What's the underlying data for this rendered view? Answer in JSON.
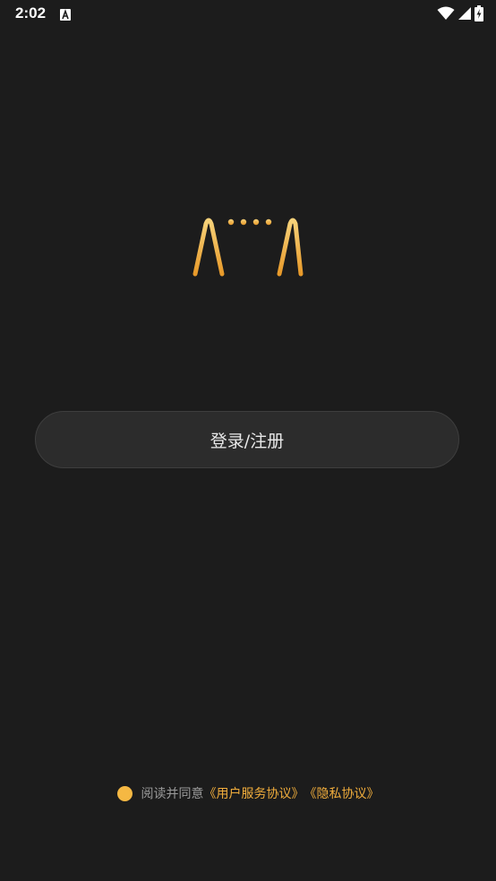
{
  "status_bar": {
    "time": "2:02",
    "notification_icon": "font-a-icon",
    "wifi_icon": "wifi-icon",
    "signal_icon": "cell-signal-icon",
    "battery_icon": "battery-charging-icon"
  },
  "logo": {
    "text": "AiiiiΛ",
    "gradient_top": "#f6d27a",
    "gradient_bottom": "#e89a2a"
  },
  "login": {
    "label": "登录/注册"
  },
  "agreement": {
    "prefix": "阅读并同意",
    "user_agreement_link": "《用户服务协议》",
    "privacy_link": "《隐私协议》",
    "checked": true,
    "accent": "#f5b843"
  },
  "colors": {
    "background": "#1c1c1c",
    "button_bg": "#2c2c2c",
    "link": "#f0ad3c"
  }
}
